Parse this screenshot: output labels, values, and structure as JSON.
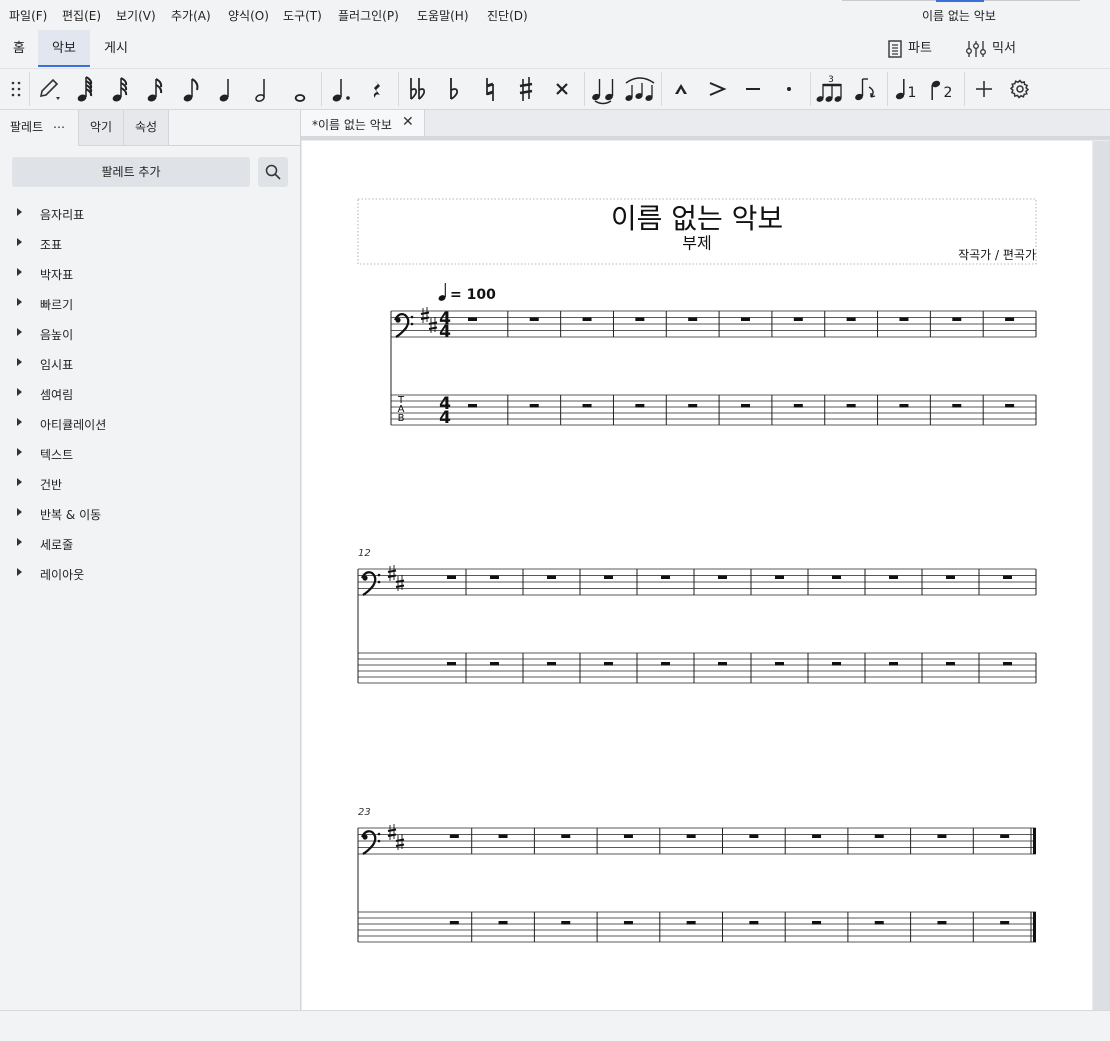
{
  "menu": [
    "파일(F)",
    "편집(E)",
    "보기(V)",
    "추가(A)",
    "양식(O)",
    "도구(T)",
    "플러그인(P)",
    "도움말(H)",
    "진단(D)"
  ],
  "window_title": "이름 없는 악보",
  "workspace_tabs": [
    "홈",
    "악보",
    "게시"
  ],
  "right_buttons": {
    "parts": "파트",
    "mixer": "믹서"
  },
  "toolbar_icons": [
    "drag-handle-icon",
    "pencil-icon",
    "64th-note-icon",
    "32nd-note-icon",
    "16th-note-icon",
    "eighth-note-icon",
    "quarter-note-icon",
    "half-note-icon",
    "whole-note-icon",
    "dotted-note-icon",
    "rest-icon",
    "double-flat-icon",
    "flat-icon",
    "natural-icon",
    "sharp-icon",
    "double-sharp-icon",
    "tie-icon",
    "slur-icon",
    "marcato-icon",
    "accent-icon",
    "tenuto-icon",
    "staccato-icon",
    "tuplet-icon",
    "flip-icon",
    "voice-1-icon",
    "voice-2-icon",
    "add-icon",
    "settings-icon"
  ],
  "left_panel": {
    "tabs": [
      "팔레트",
      "악기",
      "속성"
    ],
    "more": "⋯",
    "add_palette": "팔레트 추가",
    "items": [
      "음자리표",
      "조표",
      "박자표",
      "빠르기",
      "음높이",
      "임시표",
      "셈여림",
      "아티큘레이션",
      "텍스트",
      "건반",
      "반복 & 이동",
      "세로줄",
      "레이아웃"
    ]
  },
  "document": {
    "tab_title": "*이름 없는 악보",
    "score_title": "이름 없는 악보",
    "subtitle": "부제",
    "composer": "작곡가 / 편곡가",
    "tempo": "= 100",
    "key": "D major (2 sharps)",
    "clef": "bass",
    "time_signature": "4/4",
    "systems": [
      {
        "measure_number": "",
        "measures": 11
      },
      {
        "measure_number": "12",
        "measures": 11
      },
      {
        "measure_number": "23",
        "measures": 10
      }
    ],
    "tab_label": [
      "T",
      "A",
      "B"
    ]
  },
  "colors": {
    "accent": "#3d6fd8",
    "panel_bg": "#f2f3f5",
    "page_bg": "#ffffff"
  }
}
